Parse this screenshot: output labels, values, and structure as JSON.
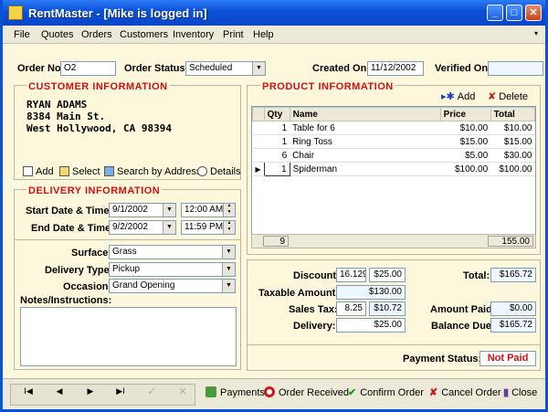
{
  "window": {
    "title": "RentMaster - [Mike is logged in]",
    "min": "_",
    "max": "□",
    "close": "✕"
  },
  "menu": [
    "File",
    "Quotes",
    "Orders",
    "Customers",
    "Inventory",
    "Print",
    "Help"
  ],
  "header": {
    "order_no_label": "Order No:",
    "order_no": "O2",
    "order_status_label": "Order Status:",
    "order_status": "Scheduled",
    "created_on_label": "Created On:",
    "created_on": "11/12/2002",
    "verified_on_label": "Verified On:",
    "verified_on": ""
  },
  "customer": {
    "heading": "CUSTOMER INFORMATION",
    "address": [
      "RYAN ADAMS",
      "8384 Main St.",
      "West Hollywood, CA 98394"
    ],
    "tools": {
      "add": "Add",
      "select": "Select",
      "search": "Search by Address",
      "details": "Details"
    }
  },
  "delivery": {
    "heading": "DELIVERY INFORMATION",
    "start_label": "Start Date & Time:",
    "start_date": "9/1/2002",
    "start_time": "12:00 AM",
    "end_label": "End Date & Time:",
    "end_date": "9/2/2002",
    "end_time": "11:59 PM",
    "surface_label": "Surface:",
    "surface": "Grass",
    "type_label": "Delivery Type:",
    "type": "Pickup",
    "occasion_label": "Occasion:",
    "occasion": "Grand Opening",
    "notes_label": "Notes/Instructions:"
  },
  "product": {
    "heading": "PRODUCT INFORMATION",
    "add": "Add",
    "delete": "Delete",
    "columns": [
      "Qty",
      "Name",
      "Price",
      "Total"
    ],
    "rows": [
      {
        "qty": "1",
        "name": "Table for 6",
        "price": "$10.00",
        "total": "$10.00"
      },
      {
        "qty": "1",
        "name": "Ring Toss",
        "price": "$15.00",
        "total": "$15.00"
      },
      {
        "qty": "6",
        "name": "Chair",
        "price": "$5.00",
        "total": "$30.00"
      },
      {
        "qty": "1",
        "name": "Spiderman",
        "price": "$100.00",
        "total": "$100.00"
      }
    ],
    "footer_qty": "9",
    "footer_total": "155.00"
  },
  "totals": {
    "discount_label": "Discount:",
    "discount_pct": "16.129",
    "discount_amt": "$25.00",
    "taxable_label": "Taxable Amount:",
    "taxable": "$130.00",
    "tax_label": "Sales Tax:",
    "tax_rate": "8.25",
    "tax_amt": "$10.72",
    "delivery_label": "Delivery:",
    "delivery": "$25.00",
    "total_label": "Total:",
    "total": "$165.72",
    "paid_label": "Amount Paid:",
    "paid": "$0.00",
    "balance_label": "Balance Due:",
    "balance": "$165.72",
    "status_label": "Payment Status:",
    "status": "Not Paid"
  },
  "bottom": {
    "first": "I◀",
    "prev": "◀",
    "next": "▶",
    "last": "▶I",
    "payments": "Payments",
    "order_received": "Order Received",
    "confirm": "Confirm Order",
    "cancel": "Cancel Order",
    "close": "Close"
  }
}
